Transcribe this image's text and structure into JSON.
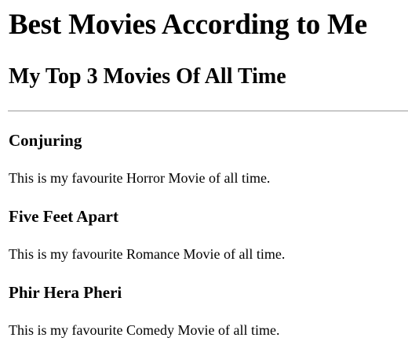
{
  "page": {
    "title": "Best Movies According to Me",
    "subtitle": "My Top 3 Movies Of All Time"
  },
  "movies": [
    {
      "title": "Conjuring",
      "description": "This is my favourite Horror Movie of all time."
    },
    {
      "title": "Five Feet Apart",
      "description": "This is my favourite Romance Movie of all time."
    },
    {
      "title": "Phir Hera Pheri",
      "description": "This is my favourite Comedy Movie of all time."
    }
  ]
}
